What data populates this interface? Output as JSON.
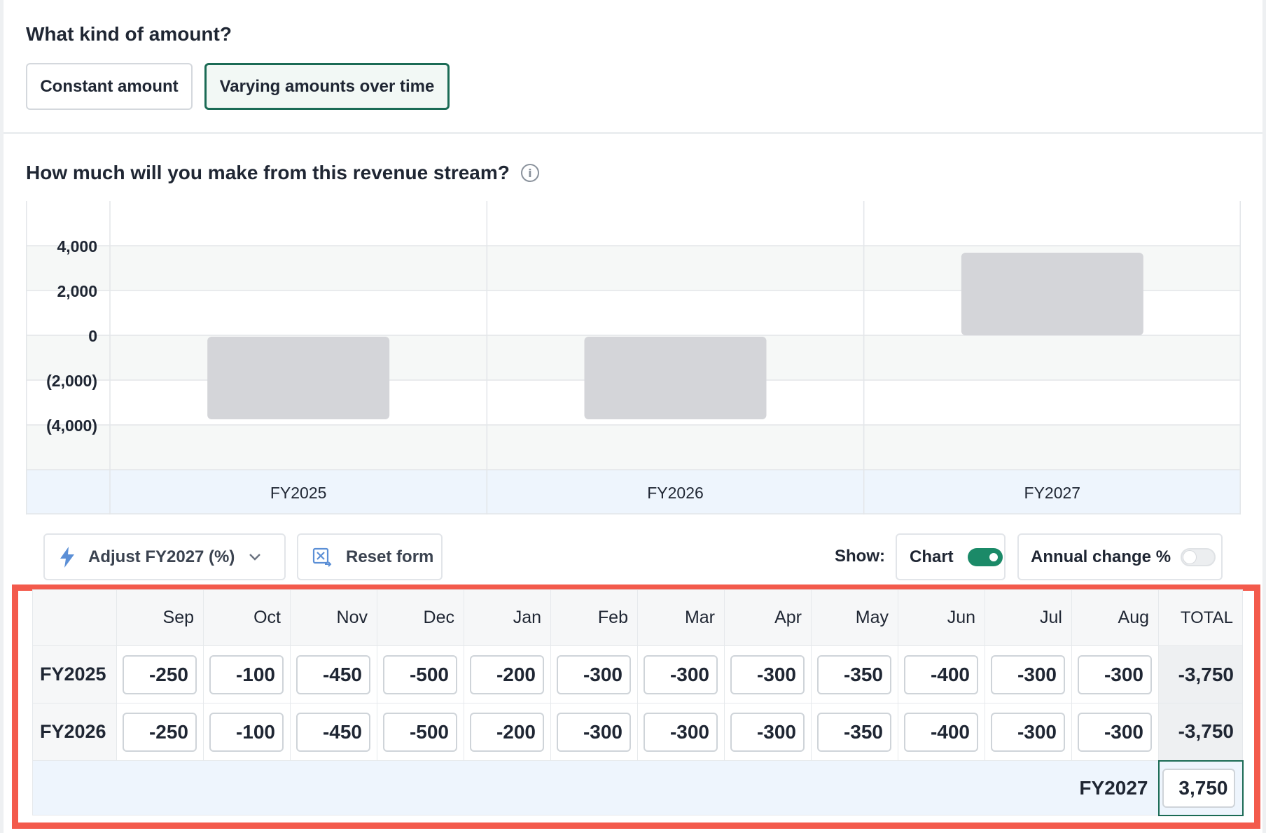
{
  "amount_kind": {
    "question": "What kind of amount?",
    "options": [
      "Constant amount",
      "Varying amounts over time"
    ],
    "selected": "Varying amounts over time"
  },
  "revenue": {
    "question": "How much will you make from this revenue stream?"
  },
  "chart_data": {
    "type": "bar",
    "categories": [
      "FY2025",
      "FY2026",
      "FY2027"
    ],
    "values": [
      -3750,
      -3750,
      3750
    ],
    "yticks": [
      "4,000",
      "2,000",
      "0",
      "(2,000)",
      "(4,000)"
    ],
    "ylim": [
      -6000,
      6000
    ],
    "grid": true,
    "bar_color": "#d4d5d9"
  },
  "toolbar": {
    "adjust_label": "Adjust FY2027 (%)",
    "reset_label": "Reset form",
    "show_label": "Show:",
    "chart_toggle_label": "Chart",
    "chart_toggle_on": true,
    "annual_change_label": "Annual change %",
    "annual_change_on": false
  },
  "grid": {
    "months": [
      "Sep",
      "Oct",
      "Nov",
      "Dec",
      "Jan",
      "Feb",
      "Mar",
      "Apr",
      "May",
      "Jun",
      "Jul",
      "Aug"
    ],
    "total_label": "TOTAL",
    "rows": [
      {
        "label": "FY2025",
        "values": [
          "-250",
          "-100",
          "-450",
          "-500",
          "-200",
          "-300",
          "-300",
          "-300",
          "-350",
          "-400",
          "-300",
          "-300"
        ],
        "total": "-3,750"
      },
      {
        "label": "FY2026",
        "values": [
          "-250",
          "-100",
          "-450",
          "-500",
          "-200",
          "-300",
          "-300",
          "-300",
          "-350",
          "-400",
          "-300",
          "-300"
        ],
        "total": "-3,750"
      }
    ],
    "fy2027_label": "FY2027",
    "fy2027_value": "3,750"
  },
  "colors": {
    "accent": "#1b6b55",
    "highlight_border": "#f35a4c",
    "toggle_on": "#1b8a68"
  }
}
